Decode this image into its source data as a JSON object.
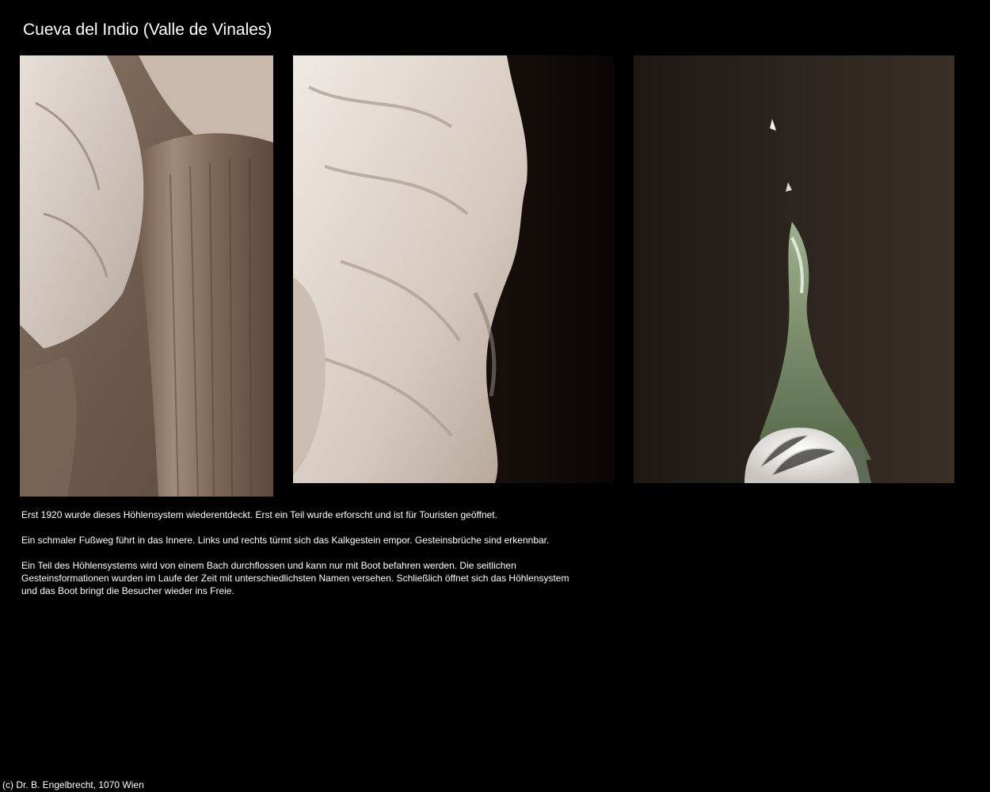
{
  "page": {
    "title": "Cueva del Indio (Valle de Vinales)",
    "background_color": "#000000",
    "text_color": "#ffffff"
  },
  "photos": [
    {
      "name": "photo-stalactite-column",
      "subject": "flowstone column in cave"
    },
    {
      "name": "photo-limestone-wall",
      "subject": "pale limestone formation beside dark passage"
    },
    {
      "name": "photo-cave-exit-boat",
      "subject": "cave exit opening toward greenery from boat"
    }
  ],
  "description": {
    "paragraphs": [
      "Erst 1920 wurde dieses Höhlensystem wiederentdeckt. Erst ein Teil wurde erforscht und ist für Touristen geöffnet.",
      "Ein schmaler Fußweg führt in das Innere. Links und rechts türmt sich das Kalkgestein empor. Gesteinsbrüche sind erkennbar.",
      "Ein Teil des Höhlensystems wird von einem Bach durchflossen und kann nur mit Boot befahren werden. Die seitlichen Gesteinsformationen wurden im Laufe der Zeit mit unterschiedlichsten Namen versehen. Schließlich öffnet sich das Höhlensystem und das Boot bringt die Besucher wieder ins Freie."
    ]
  },
  "footer": {
    "copyright": "(c) Dr. B. Engelbrecht, 1070 Wien"
  }
}
